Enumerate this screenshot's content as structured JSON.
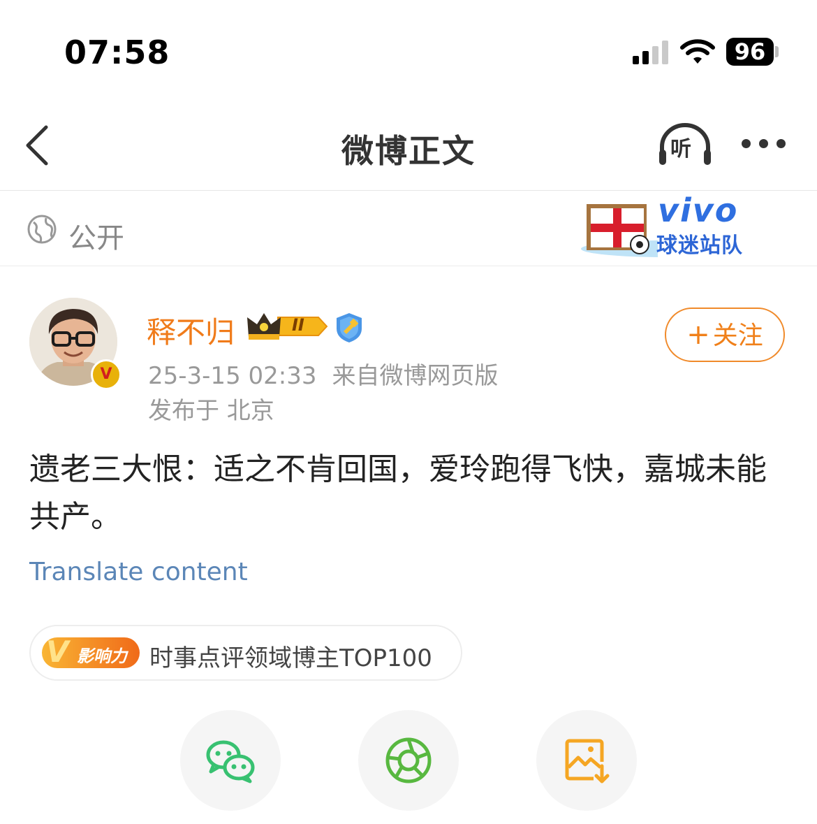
{
  "status_bar": {
    "time": "07:58",
    "battery": "96"
  },
  "nav": {
    "title": "微博正文",
    "listen_label": "听"
  },
  "visibility": {
    "label": "公开",
    "banner": {
      "brand": "vivo",
      "subtitle": "球迷站队"
    }
  },
  "author": {
    "name": "释不归",
    "level_badge": "II",
    "verified_badge": "V",
    "post_time": "25-3-15 02:33",
    "source": "来自微博网页版",
    "location": "发布于 北京",
    "follow_label": "关注",
    "follow_plus": "+"
  },
  "post": {
    "text": "遗老三大恨：适之不肯回国，爱玲跑得飞快，嘉城未能共产。",
    "translate_label": "Translate content"
  },
  "influence": {
    "badge_v": "V",
    "badge_label": "影响力",
    "text": "时事点评领域博主TOP100"
  },
  "colors": {
    "author_name": "#f07b1a",
    "follow_border": "#f08a2a",
    "link": "#5b86b7",
    "wechat_green": "#38c171",
    "moments_green": "#58b840",
    "save_orange": "#f5a623"
  },
  "icons": {
    "back": "chevron-left-icon",
    "listen": "headphones-icon",
    "more": "more-dots-icon",
    "globe": "globe-icon",
    "wechat": "wechat-icon",
    "moments": "moments-icon",
    "save_image": "save-image-icon"
  }
}
